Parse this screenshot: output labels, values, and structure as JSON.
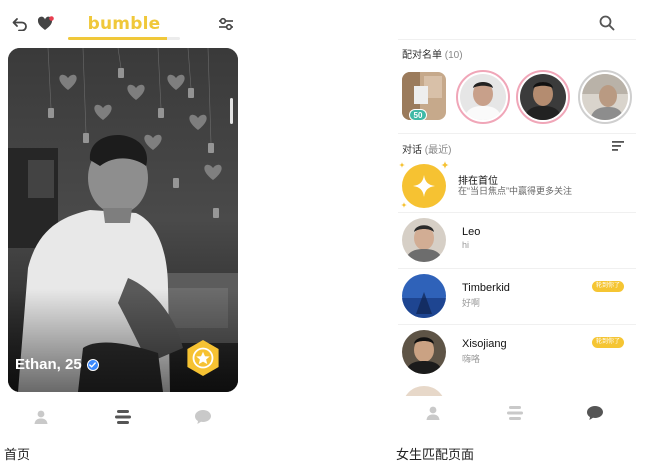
{
  "left": {
    "brand": "bumble",
    "profile_name": "Ethan, 25",
    "caption": "首页",
    "icons": [
      "undo-icon",
      "heart-icon",
      "filter-icon",
      "verified-icon",
      "star-icon",
      "profile-icon",
      "stack-icon",
      "chat-icon"
    ]
  },
  "right": {
    "matches_label": "配对名单",
    "matches_count": "(10)",
    "badge": "50",
    "conversations_label": "对话",
    "conversations_sub": "(最近)",
    "promo": {
      "title": "排在首位",
      "subtitle": "在“当日焦点”中赢得更多关注"
    },
    "conversations": [
      {
        "name": "Leo",
        "message": "hi",
        "tag": ""
      },
      {
        "name": "Timberkid",
        "message": "好啊",
        "tag": "轮到你了"
      },
      {
        "name": "Xisojiang",
        "message": "嗨咯",
        "tag": "轮到你了"
      }
    ],
    "caption": "女生匹配页面",
    "icons": [
      "search-icon",
      "menu-icon",
      "profile-icon",
      "stack-icon",
      "chat-icon"
    ]
  },
  "colors": {
    "accent": "#f0c83a",
    "tag": "#f5c533",
    "badge": "#3fb9a6",
    "ring": "#f0a6b8",
    "verified": "#3a89ff"
  }
}
